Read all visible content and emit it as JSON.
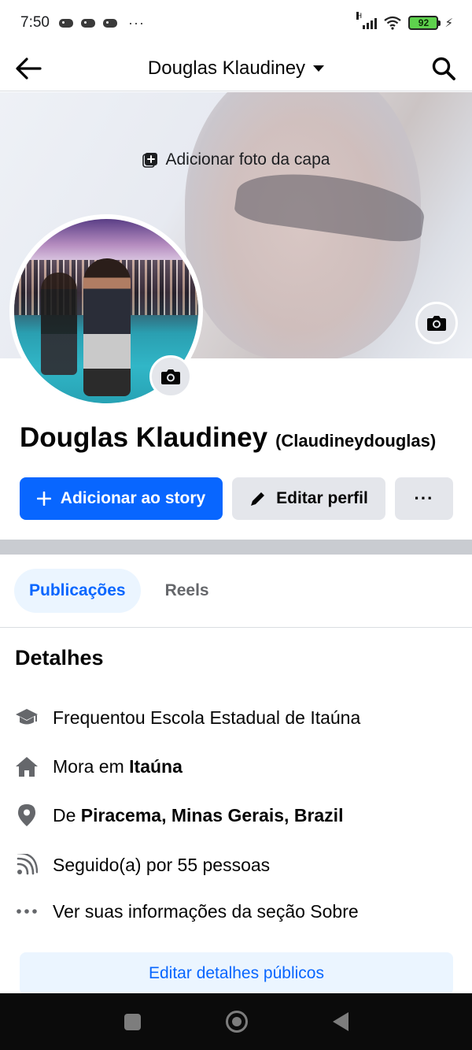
{
  "status_bar": {
    "time": "7:50",
    "more": "···",
    "network": "H",
    "battery": "92"
  },
  "nav": {
    "title": "Douglas Klaudiney"
  },
  "cover": {
    "add_label": "Adicionar foto da capa"
  },
  "profile": {
    "name": "Douglas Klaudiney",
    "alternate_name": "(Claudineydouglas)"
  },
  "actions": {
    "add_story": "Adicionar ao story",
    "edit_profile": "Editar perfil",
    "more": "···"
  },
  "tabs": [
    {
      "label": "Publicações",
      "active": true
    },
    {
      "label": "Reels",
      "active": false
    }
  ],
  "details": {
    "heading": "Detalhes",
    "school": "Frequentou Escola Estadual de Itaúna",
    "lives_prefix": "Mora em ",
    "lives_city": "Itaúna",
    "from_prefix": "De ",
    "from_place": "Piracema, Minas Gerais, Brazil",
    "followers": "Seguido(a) por 55 pessoas",
    "about": "Ver suas informações da seção Sobre"
  },
  "edit_public_details": "Editar detalhes públicos",
  "colors": {
    "accent": "#0866ff",
    "accent_light": "#ebf5ff",
    "secondary_button": "#e4e6eb",
    "muted_text": "#65676b"
  },
  "icons": {
    "back": "arrow-left-icon",
    "search": "search-icon",
    "add_photo": "add-photo-icon",
    "camera": "camera-icon",
    "plus": "plus-icon",
    "pencil": "pencil-icon",
    "school": "graduation-cap-icon",
    "home": "home-icon",
    "location": "location-pin-icon",
    "followers": "rss-icon",
    "more": "more-dots-icon"
  }
}
